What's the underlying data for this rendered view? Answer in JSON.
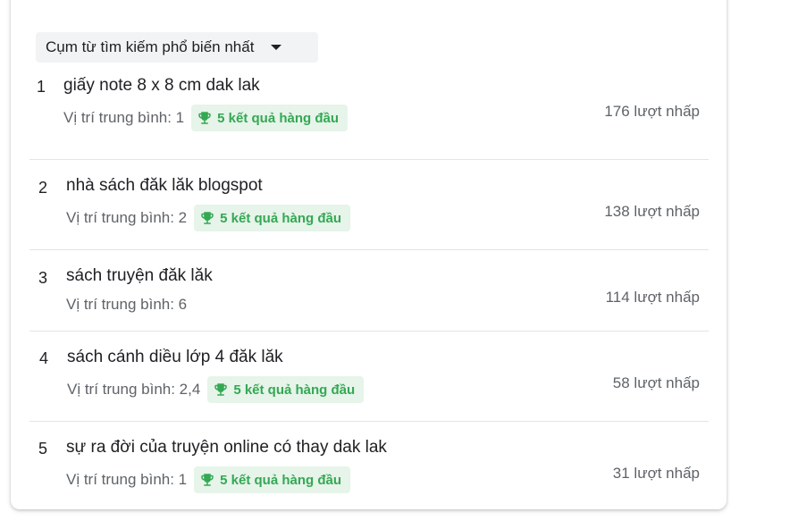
{
  "header": {
    "dropdown_label": "Cụm từ tìm kiếm phổ biến nhất"
  },
  "queries": [
    {
      "rank": "1",
      "text": "giấy note 8 x 8 cm dak lak",
      "avg": "Vị trí trung bình: 1",
      "badge": "5 kết quả hàng đầu",
      "clicks": "176 lượt nhấp"
    },
    {
      "rank": "2",
      "text": "nhà sách đăk lăk blogspot",
      "avg": "Vị trí trung bình: 2",
      "badge": "5 kết quả hàng đầu",
      "clicks": "138 lượt nhấp"
    },
    {
      "rank": "3",
      "text": "sách truyện đăk lăk",
      "avg": "Vị trí trung bình: 6",
      "badge": null,
      "clicks": "114 lượt nhấp"
    },
    {
      "rank": "4",
      "text": "sách cánh diều lớp 4 đăk lăk",
      "avg": "Vị trí trung bình: 2,4",
      "badge": "5 kết quả hàng đầu",
      "clicks": "58 lượt nhấp"
    },
    {
      "rank": "5",
      "text": "sự ra đời của truyện online có thay dak lak",
      "avg": "Vị trí trung bình: 1",
      "badge": "5 kết quả hàng đầu",
      "clicks": "31 lượt nhấp"
    }
  ],
  "colors": {
    "badge_bg": "#e6f4ea",
    "badge_fg": "#34a853"
  },
  "icons": {
    "badge": "trophy-icon",
    "dropdown": "caret-down-icon"
  }
}
